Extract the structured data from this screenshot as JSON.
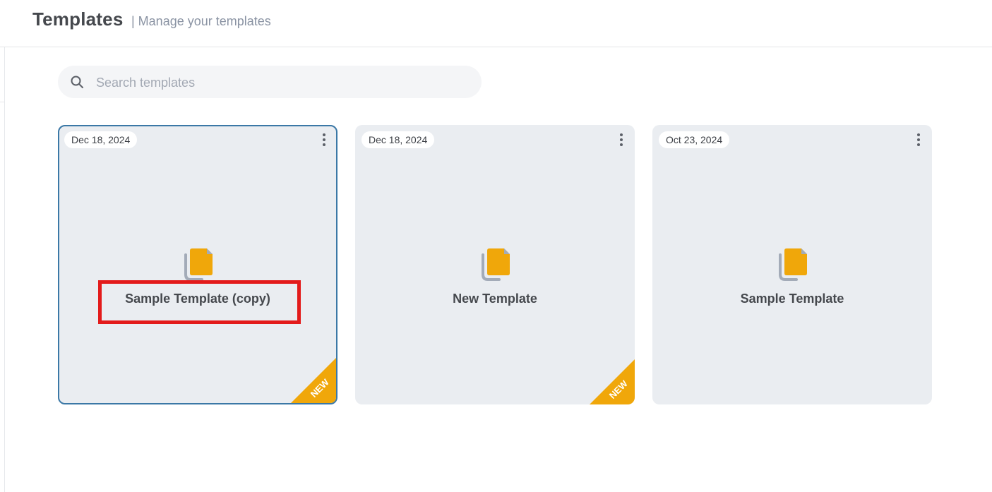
{
  "header": {
    "title": "Templates",
    "subtitle": "| Manage your templates"
  },
  "search": {
    "placeholder": "Search templates",
    "value": "",
    "icon": "search-icon"
  },
  "cards": [
    {
      "date": "Dec 18, 2024",
      "name": "Sample Template (copy)",
      "is_new": true,
      "selected": true,
      "badge": "NEW"
    },
    {
      "date": "Dec 18, 2024",
      "name": "New Template",
      "is_new": true,
      "selected": false,
      "badge": "NEW"
    },
    {
      "date": "Oct 23, 2024",
      "name": "Sample Template",
      "is_new": false,
      "selected": false
    }
  ],
  "colors": {
    "accent_doc": "#f0a70a",
    "doc_back": "#a3abb8",
    "selected_border": "#3b78a6",
    "highlight": "#e31b1b",
    "card_bg": "#eaedf1"
  }
}
